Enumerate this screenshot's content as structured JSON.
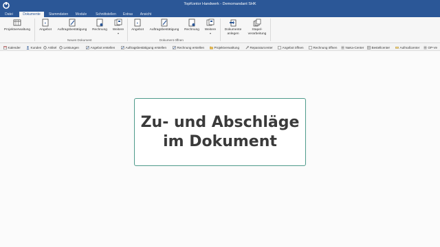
{
  "window": {
    "title": "TopKontor Handwerk - Demomandant SHK"
  },
  "tabs": [
    {
      "label": "Datei"
    },
    {
      "label": "Dokumente"
    },
    {
      "label": "Stammdaten"
    },
    {
      "label": "Module"
    },
    {
      "label": "Schnittstellen"
    },
    {
      "label": "Extras"
    },
    {
      "label": "Ansicht"
    }
  ],
  "ribbon": {
    "projektverwaltung": "Projektverwaltung",
    "neues_dokument": {
      "group_label": "Neues Dokument",
      "angebot": "Angebot",
      "auftragsbestaetigung": "Auftragsbestätigung",
      "rechnung": "Rechnung",
      "weitere": "Weitere"
    },
    "dokument_oeffnen": {
      "group_label": "Dokument öffnen",
      "angebot": "Angebot",
      "auftragsbestaetigung": "Auftragsbestätigung",
      "rechnung": "Rechnung",
      "weitere": "Weitere"
    },
    "dokumente_anlegen": {
      "line1": "Dokumente",
      "line2": "anlegen"
    },
    "stapelverarbeitung": {
      "line1": "Stapel-",
      "line2": "verarbeitung"
    }
  },
  "quickbar": [
    {
      "label": "Kalender",
      "icon": "calendar-icon"
    },
    {
      "label": "Kunden",
      "icon": "person-icon"
    },
    {
      "label": "Artikel",
      "icon": "gear-icon"
    },
    {
      "label": "Leistungen",
      "icon": "gear-icon"
    },
    {
      "label": "Angebot erstellen",
      "icon": "document-edit-icon"
    },
    {
      "label": "Auftragsbestätigung erstellen",
      "icon": "document-edit-icon"
    },
    {
      "label": "Rechnung erstellen",
      "icon": "document-edit-icon"
    },
    {
      "label": "Projektverwaltung",
      "icon": "folder-icon"
    },
    {
      "label": "Reparaturcenter",
      "icon": "wrench-icon"
    },
    {
      "label": "Angebot öffnen",
      "icon": "document-icon"
    },
    {
      "label": "Rechnung öffnen",
      "icon": "document-icon"
    },
    {
      "label": "NaKa-Center",
      "icon": "list-icon"
    },
    {
      "label": "Bestellcenter",
      "icon": "grid-icon"
    },
    {
      "label": "Aufmaßcenter",
      "icon": "ruler-icon"
    },
    {
      "label": "OP-Ve",
      "icon": "list-icon"
    }
  ],
  "main": {
    "title_line1": "Zu- und Abschläge",
    "title_line2": "im Dokument"
  },
  "colors": {
    "titlebar": "#2b5797",
    "card_border": "#4d9a8a",
    "title_text": "#3a3a3a"
  }
}
